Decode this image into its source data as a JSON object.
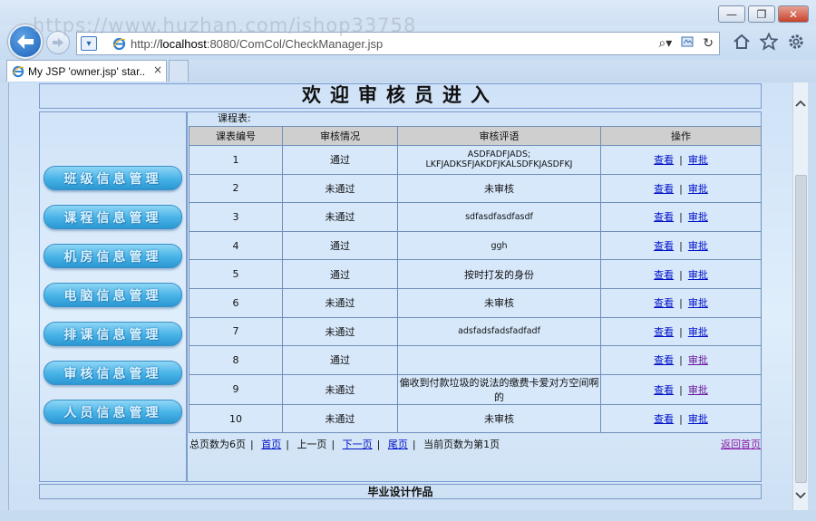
{
  "watermark": "https://www.huzhan.com/ishop33758",
  "browser": {
    "url_prefix": "http://",
    "url_host": "localhost",
    "url_rest": ":8080/ComCol/CheckManager.jsp",
    "tab_title": "My JSP 'owner.jsp' star...",
    "tab_close": "×",
    "window_controls": {
      "minimize": "—",
      "maximize": "❐",
      "close": "✕"
    }
  },
  "page": {
    "title": "欢迎审核员进入",
    "footer": "毕业设计作品"
  },
  "menu": [
    {
      "label": "班级信息管理"
    },
    {
      "label": "课程信息管理"
    },
    {
      "label": "机房信息管理"
    },
    {
      "label": "电脑信息管理"
    },
    {
      "label": "排课信息管理"
    },
    {
      "label": "审核信息管理"
    },
    {
      "label": "人员信息管理"
    }
  ],
  "table": {
    "caption": "课程表:",
    "headers": [
      "课表编号",
      "审核情况",
      "审核评语",
      "操作"
    ],
    "rows": [
      {
        "id": "1",
        "status": "通过",
        "comment": "ASDFADFJADS; LKFJADKSFJAKDFJKALSDFKJASDFKJ",
        "view": "查看",
        "approve": "审批"
      },
      {
        "id": "2",
        "status": "未通过",
        "comment": "未审核",
        "view": "查看",
        "approve": "审批"
      },
      {
        "id": "3",
        "status": "未通过",
        "comment": "sdfasdfasdfasdf",
        "view": "查看",
        "approve": "审批"
      },
      {
        "id": "4",
        "status": "通过",
        "comment": "ggh",
        "view": "查看",
        "approve": "审批"
      },
      {
        "id": "5",
        "status": "通过",
        "comment": "按时打发的身份",
        "view": "查看",
        "approve": "审批"
      },
      {
        "id": "6",
        "status": "未通过",
        "comment": "未审核",
        "view": "查看",
        "approve": "审批"
      },
      {
        "id": "7",
        "status": "未通过",
        "comment": "adsfadsfadsfadfadf",
        "view": "查看",
        "approve": "审批"
      },
      {
        "id": "8",
        "status": "通过",
        "comment": "",
        "view": "查看",
        "approve": "审批"
      },
      {
        "id": "9",
        "status": "未通过",
        "comment": "偏收到付款垃圾的说法的缴费卡爱对方空间啊的",
        "view": "查看",
        "approve": "审批"
      },
      {
        "id": "10",
        "status": "未通过",
        "comment": "未审核",
        "view": "查看",
        "approve": "审批"
      }
    ]
  },
  "pager": {
    "total": "总页数为6页",
    "first": "首页",
    "prev": "上一页",
    "next": "下一页",
    "last": "尾页",
    "current": "当前页数为第1页",
    "home": "返回首页"
  }
}
